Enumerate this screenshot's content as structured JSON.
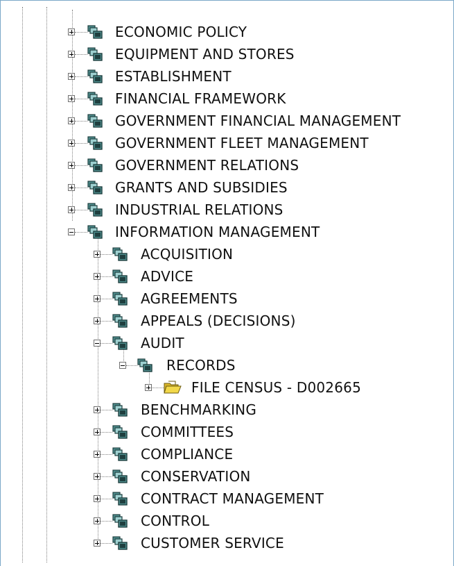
{
  "tree": {
    "items": [
      {
        "label": "ECONOMIC POLICY",
        "level": 0,
        "state": "collapsed",
        "icon": "group-icon"
      },
      {
        "label": "EQUIPMENT AND STORES",
        "level": 0,
        "state": "collapsed",
        "icon": "group-icon"
      },
      {
        "label": "ESTABLISHMENT",
        "level": 0,
        "state": "collapsed",
        "icon": "group-icon"
      },
      {
        "label": "FINANCIAL FRAMEWORK",
        "level": 0,
        "state": "collapsed",
        "icon": "group-icon"
      },
      {
        "label": "GOVERNMENT FINANCIAL MANAGEMENT",
        "level": 0,
        "state": "collapsed",
        "icon": "group-icon"
      },
      {
        "label": "GOVERNMENT FLEET MANAGEMENT",
        "level": 0,
        "state": "collapsed",
        "icon": "group-icon"
      },
      {
        "label": "GOVERNMENT RELATIONS",
        "level": 0,
        "state": "collapsed",
        "icon": "group-icon"
      },
      {
        "label": "GRANTS AND SUBSIDIES",
        "level": 0,
        "state": "collapsed",
        "icon": "group-icon"
      },
      {
        "label": "INDUSTRIAL RELATIONS",
        "level": 0,
        "state": "collapsed",
        "icon": "group-icon"
      },
      {
        "label": "INFORMATION MANAGEMENT",
        "level": 0,
        "state": "expanded",
        "icon": "group-icon"
      },
      {
        "label": "ACQUISITION",
        "level": 1,
        "state": "collapsed",
        "icon": "group-icon"
      },
      {
        "label": "ADVICE",
        "level": 1,
        "state": "collapsed",
        "icon": "group-icon"
      },
      {
        "label": "AGREEMENTS",
        "level": 1,
        "state": "collapsed",
        "icon": "group-icon"
      },
      {
        "label": "APPEALS (DECISIONS)",
        "level": 1,
        "state": "collapsed",
        "icon": "group-icon"
      },
      {
        "label": "AUDIT",
        "level": 1,
        "state": "expanded",
        "icon": "group-icon"
      },
      {
        "label": "RECORDS",
        "level": 2,
        "state": "expanded",
        "icon": "group-icon"
      },
      {
        "label": "FILE CENSUS - D002665",
        "level": 3,
        "state": "collapsed",
        "icon": "folder-icon"
      },
      {
        "label": "BENCHMARKING",
        "level": 1,
        "state": "collapsed",
        "icon": "group-icon"
      },
      {
        "label": "COMMITTEES",
        "level": 1,
        "state": "collapsed",
        "icon": "group-icon"
      },
      {
        "label": "COMPLIANCE",
        "level": 1,
        "state": "collapsed",
        "icon": "group-icon"
      },
      {
        "label": "CONSERVATION",
        "level": 1,
        "state": "collapsed",
        "icon": "group-icon"
      },
      {
        "label": "CONTRACT MANAGEMENT",
        "level": 1,
        "state": "collapsed",
        "icon": "group-icon"
      },
      {
        "label": "CONTROL",
        "level": 1,
        "state": "collapsed",
        "icon": "group-icon"
      },
      {
        "label": "CUSTOMER SERVICE",
        "level": 1,
        "state": "collapsed",
        "icon": "group-icon"
      }
    ]
  },
  "colors": {
    "border": "#7aa7c7",
    "icon_fill": "#4f8f8f",
    "icon_dark": "#1f3f3f",
    "folder_fill": "#f2d84a"
  }
}
